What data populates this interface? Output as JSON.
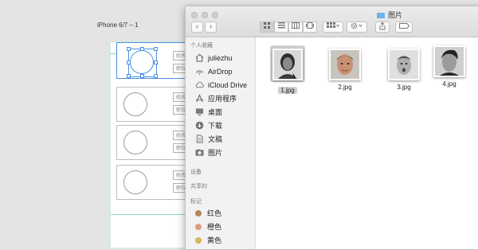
{
  "canvas": {
    "artboard_title": "iPhone 6/7 – 1",
    "cards": [
      {
        "name_label": "姓名",
        "title_label": "职位",
        "selected": true
      },
      {
        "name_label": "姓名",
        "title_label": "职位",
        "selected": false
      },
      {
        "name_label": "姓名",
        "title_label": "职位",
        "selected": false
      },
      {
        "name_label": "姓名",
        "title_label": "职位",
        "selected": false
      }
    ]
  },
  "finder": {
    "title": "图片",
    "nav": {
      "back": "‹",
      "forward": "›"
    },
    "sidebar": {
      "sections": [
        {
          "label": "个人收藏"
        },
        {
          "label": "设备"
        },
        {
          "label": "共享的"
        },
        {
          "label": "标记"
        }
      ],
      "favorites": [
        {
          "label": "juliezhu",
          "icon": "home-icon"
        },
        {
          "label": "AirDrop",
          "icon": "airdrop-icon"
        },
        {
          "label": "iCloud Drive",
          "icon": "cloud-icon"
        },
        {
          "label": "应用程序",
          "icon": "applications-icon"
        },
        {
          "label": "桌面",
          "icon": "desktop-icon"
        },
        {
          "label": "下载",
          "icon": "download-icon"
        },
        {
          "label": "文稿",
          "icon": "documents-icon"
        },
        {
          "label": "图片",
          "icon": "pictures-icon"
        }
      ],
      "tags": [
        {
          "label": "红色",
          "color": "#b5865a"
        },
        {
          "label": "橙色",
          "color": "#d9a07a"
        },
        {
          "label": "黄色",
          "color": "#d8b45a"
        }
      ]
    },
    "files": [
      {
        "name": "1.jpg",
        "selected": true
      },
      {
        "name": "2.jpg",
        "selected": false
      },
      {
        "name": "3.jpg",
        "selected": false
      },
      {
        "name": "4.jpg",
        "selected": false
      }
    ]
  }
}
